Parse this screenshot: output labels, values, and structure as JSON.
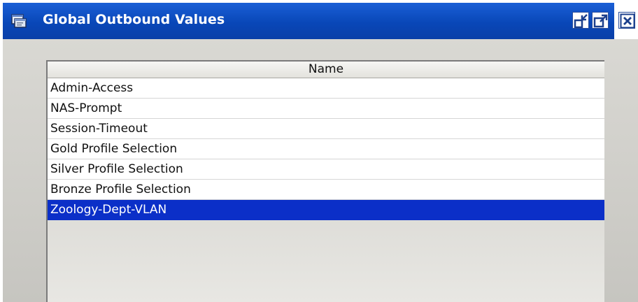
{
  "window": {
    "title": "Global Outbound Values"
  },
  "table": {
    "column_header": "Name",
    "rows": [
      {
        "name": "Admin-Access",
        "selected": false
      },
      {
        "name": "NAS-Prompt",
        "selected": false
      },
      {
        "name": "Session-Timeout",
        "selected": false
      },
      {
        "name": "Gold Profile Selection",
        "selected": false
      },
      {
        "name": "Silver Profile Selection",
        "selected": false
      },
      {
        "name": "Bronze Profile Selection",
        "selected": false
      },
      {
        "name": "Zoology-Dept-VLAN",
        "selected": true
      }
    ]
  },
  "icons": {
    "window_icon": "app-window-icon",
    "minimize": "restore-down-icon",
    "maximize": "maximize-icon",
    "close": "close-icon"
  },
  "colors": {
    "titlebar": "#0947b8",
    "selection": "#0b2fc8",
    "panel": "#d2d1cc"
  }
}
